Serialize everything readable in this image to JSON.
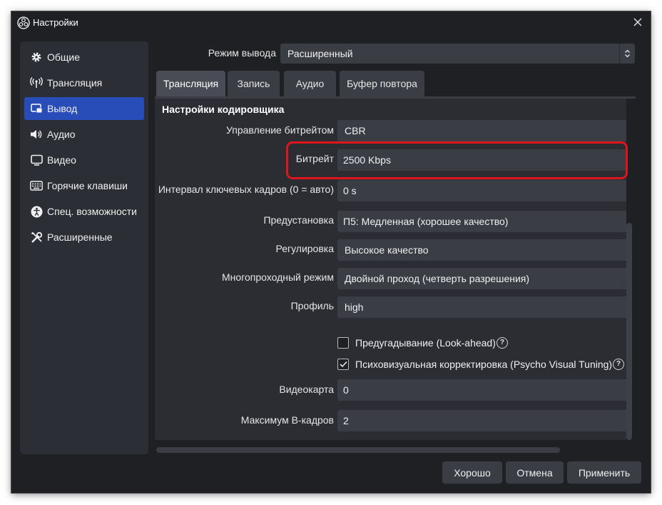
{
  "window": {
    "title": "Настройки",
    "app_icon": "obs-logo-icon",
    "close_icon": "close-icon"
  },
  "sidebar": {
    "items": [
      {
        "label": "Общие",
        "icon": "gear-icon",
        "active": false
      },
      {
        "label": "Трансляция",
        "icon": "broadcast-antenna-icon",
        "active": false
      },
      {
        "label": "Вывод",
        "icon": "output-monitor-icon",
        "active": true
      },
      {
        "label": "Аудио",
        "icon": "speaker-icon",
        "active": false
      },
      {
        "label": "Видео",
        "icon": "monitor-icon",
        "active": false
      },
      {
        "label": "Горячие клавиши",
        "icon": "keyboard-icon",
        "active": false
      },
      {
        "label": "Спец. возможности",
        "icon": "accessibility-icon",
        "active": false
      },
      {
        "label": "Расширенные",
        "icon": "tools-icon",
        "active": false
      }
    ]
  },
  "output_mode": {
    "label": "Режим вывода",
    "value": "Расширенный"
  },
  "tabs": [
    {
      "label": "Трансляция",
      "active": true
    },
    {
      "label": "Запись",
      "active": false
    },
    {
      "label": "Аудио",
      "active": false
    },
    {
      "label": "Буфер повтора",
      "active": false
    }
  ],
  "encoder": {
    "section_title": "Настройки кодировщика",
    "rate_control": {
      "label": "Управление битрейтом",
      "value": "CBR"
    },
    "bitrate": {
      "label": "Битрейт",
      "value": "2500 Kbps"
    },
    "keyframe_interval": {
      "label": "Интервал ключевых кадров (0 = авто)",
      "value": "0 s"
    },
    "preset": {
      "label": "Предустановка",
      "value": "П5: Медленная (хорошее качество)"
    },
    "tuning": {
      "label": "Регулировка",
      "value": "Высокое качество"
    },
    "multipass": {
      "label": "Многопроходный режим",
      "value": "Двойной проход (четверть разрешения)"
    },
    "profile": {
      "label": "Профиль",
      "value": "high"
    },
    "lookahead": {
      "label": "Предугадывание (Look-ahead)",
      "checked": false
    },
    "psycho_visual": {
      "label": "Психовизуальная корректировка (Psycho Visual Tuning)",
      "checked": true
    },
    "gpu": {
      "label": "Видеокарта",
      "value": "0"
    },
    "max_bframes": {
      "label": "Максимум B-кадров",
      "value": "2"
    }
  },
  "buttons": {
    "ok": "Хорошо",
    "cancel": "Отмена",
    "apply": "Применить"
  },
  "colors": {
    "accent": "#284cb8",
    "highlight": "#e0141c",
    "background": "#1f2024"
  }
}
